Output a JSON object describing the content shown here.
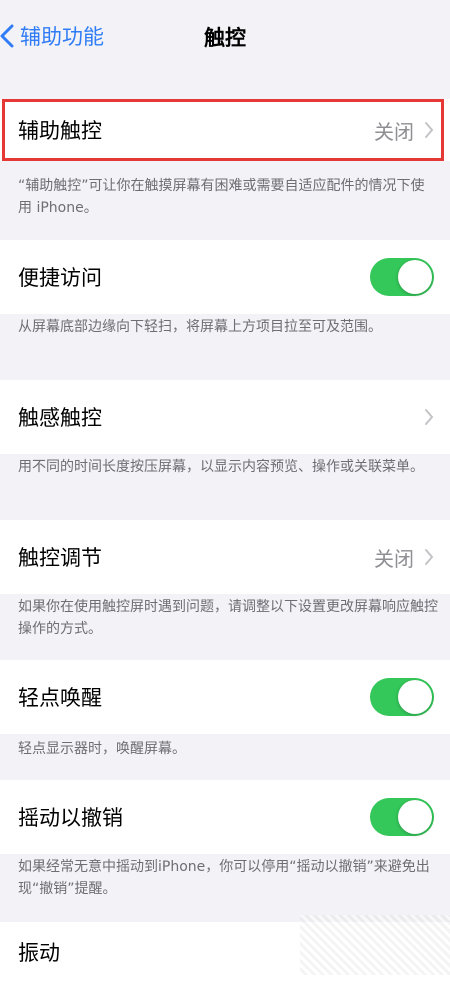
{
  "nav": {
    "back_label": "辅助功能",
    "title": "触控"
  },
  "rows": [
    {
      "label": "辅助触控",
      "value": "关闭",
      "type": "disclosure"
    },
    {
      "label": "便捷访问",
      "type": "toggle",
      "on": true
    },
    {
      "label": "触感触控",
      "value": "",
      "type": "disclosure"
    },
    {
      "label": "触控调节",
      "value": "关闭",
      "type": "disclosure"
    },
    {
      "label": "轻点唤醒",
      "type": "toggle",
      "on": true
    },
    {
      "label": "摇动以撤销",
      "type": "toggle",
      "on": true
    },
    {
      "label": "振动"
    }
  ],
  "descriptions": [
    "“辅助触控”可让你在触摸屏幕有困难或需要自适应配件的情况下使用 iPhone。",
    "从屏幕底部边缘向下轻扫，将屏幕上方项目拉至可及范围。",
    "用不同的时间长度按压屏幕，以显示内容预览、操作或关联菜单。",
    "如果你在使用触控屏时遇到问题，请调整以下设置更改屏幕响应触控操作的方式。",
    "轻点显示器时，唤醒屏幕。",
    "如果经常无意中摇动到iPhone，你可以停用“摇动以撤销”来避免出现“撤销”提醒。"
  ],
  "colors": {
    "accent": "#2f7cf6",
    "toggle_on": "#34c759",
    "highlight": "#e53935"
  }
}
